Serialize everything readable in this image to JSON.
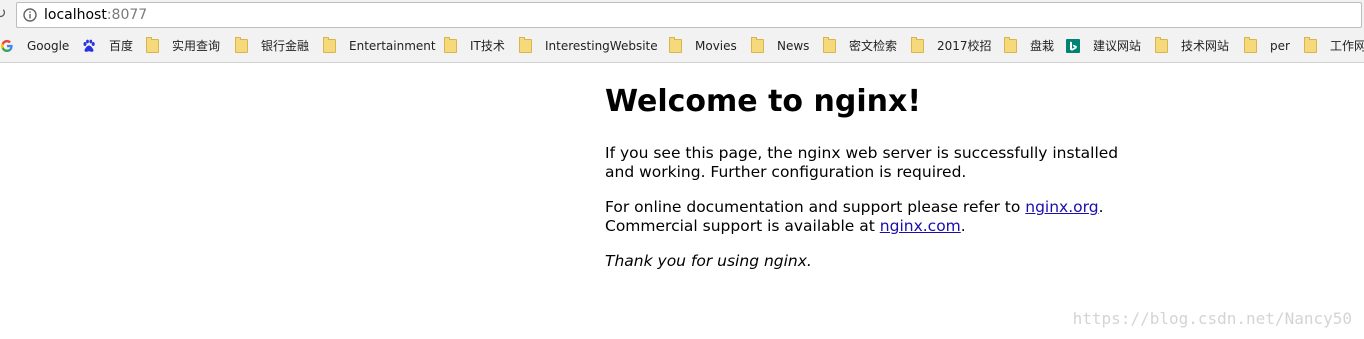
{
  "browser": {
    "url_host": "localhost",
    "url_port": ":8077"
  },
  "bookmarks": [
    {
      "label": "Google",
      "icon": "google-icon"
    },
    {
      "label": "百度",
      "icon": "baidu-paw-icon"
    },
    {
      "label": "实用查询",
      "icon": "folder-icon"
    },
    {
      "label": "银行金融",
      "icon": "folder-icon"
    },
    {
      "label": "Entertainment",
      "icon": "folder-icon"
    },
    {
      "label": "IT技术",
      "icon": "folder-icon"
    },
    {
      "label": "InterestingWebsite",
      "icon": "folder-icon"
    },
    {
      "label": "Movies",
      "icon": "folder-icon"
    },
    {
      "label": "News",
      "icon": "folder-icon"
    },
    {
      "label": "密文检索",
      "icon": "folder-icon"
    },
    {
      "label": "2017校招",
      "icon": "folder-icon"
    },
    {
      "label": "盘栽",
      "icon": "folder-icon"
    },
    {
      "label": "建议网站",
      "icon": "bing-icon"
    },
    {
      "label": "技术网站",
      "icon": "folder-icon"
    },
    {
      "label": "per",
      "icon": "folder-icon"
    },
    {
      "label": "工作网",
      "icon": "folder-icon"
    }
  ],
  "page": {
    "heading": "Welcome to nginx!",
    "p1": "If you see this page, the nginx web server is successfully installed and working. Further configuration is required.",
    "p2_before": "For online documentation and support please refer to ",
    "p2_link1": "nginx.org",
    "p2_mid": ".",
    "p2_line2": "Commercial support is available at ",
    "p2_link2": "nginx.com",
    "p2_end": ".",
    "p3": "Thank you for using nginx."
  },
  "watermark": "https://blog.csdn.net/Nancy50",
  "colors": {
    "link": "#1a0dab",
    "folder": "#f6d97a",
    "bing": "#008373"
  }
}
